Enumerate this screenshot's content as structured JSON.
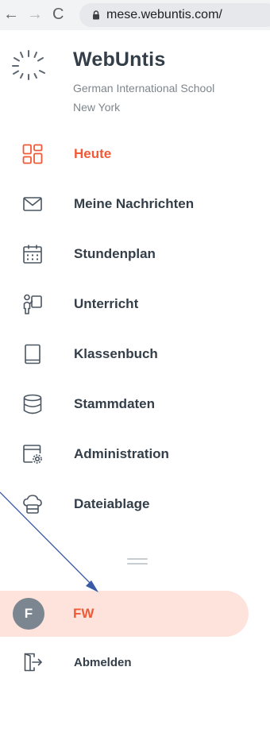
{
  "browser": {
    "back_glyph": "←",
    "forward_glyph": "→",
    "reload_glyph": "C",
    "url": "mese.webuntis.com/"
  },
  "app": {
    "title": "WebUntis",
    "school_line1": "German International School",
    "school_line2": "New York"
  },
  "menu": {
    "items": [
      {
        "label": "Heute",
        "icon": "grid-icon",
        "active": true
      },
      {
        "label": "Meine Nachrichten",
        "icon": "envelope-icon"
      },
      {
        "label": "Stundenplan",
        "icon": "calendar-icon"
      },
      {
        "label": "Unterricht",
        "icon": "teacher-icon"
      },
      {
        "label": "Klassenbuch",
        "icon": "book-icon"
      },
      {
        "label": "Stammdaten",
        "icon": "database-icon"
      },
      {
        "label": "Administration",
        "icon": "admin-gear-icon"
      },
      {
        "label": "Dateiablage",
        "icon": "cloud-storage-icon"
      }
    ]
  },
  "user": {
    "avatar_letter": "F",
    "name": "FW"
  },
  "logout": {
    "label": "Abmelden",
    "icon": "logout-door-icon"
  },
  "colors": {
    "accent": "#f05a37",
    "active_bg": "#fde3dc",
    "text": "#333e48",
    "annotation_arrow": "#3a5aa8"
  }
}
